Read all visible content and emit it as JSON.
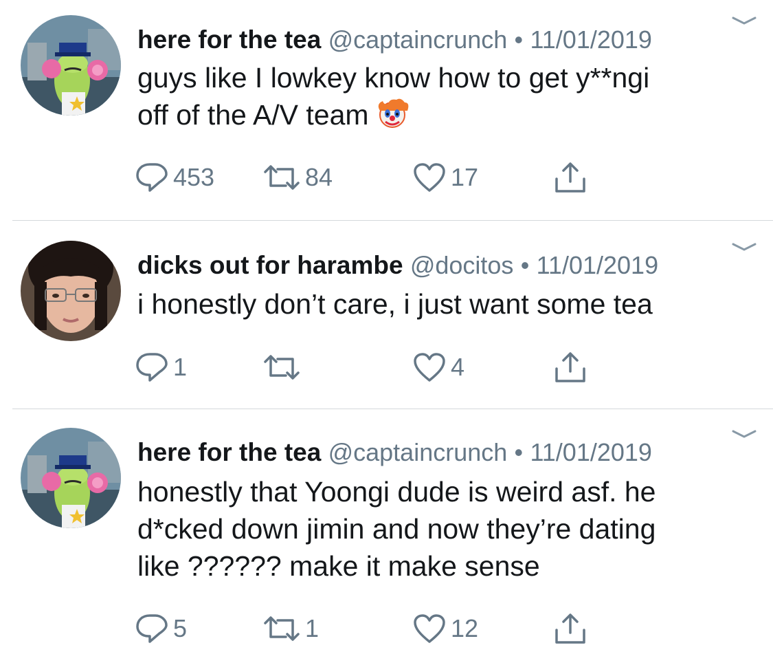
{
  "tweets": [
    {
      "display_name": "here for the tea",
      "handle": "@captaincrunch",
      "separator": "•",
      "date": "11/01/2019",
      "text_lines": [
        "guys like I lowkey know how to get y**ngi",
        "off of the A/V team"
      ],
      "emoji": "clown-face-icon",
      "replies": "453",
      "retweets": "84",
      "likes": "17",
      "avatar": "cartoon-fish-officer"
    },
    {
      "display_name": "dicks out for harambe",
      "handle": "@docitos",
      "separator": "•",
      "date": "11/01/2019",
      "text_lines": [
        "i honestly don’t care, i just want some tea"
      ],
      "replies": "1",
      "retweets": "",
      "likes": "4",
      "avatar": "person-with-glasses"
    },
    {
      "display_name": "here for the tea",
      "handle": "@captaincrunch",
      "separator": "•",
      "date": "11/01/2019",
      "text_lines": [
        "honestly that Yoongi dude is weird asf. he",
        "d*cked down jimin and now they’re dating",
        "like ?????? make it make sense"
      ],
      "replies": "5",
      "retweets": "1",
      "likes": "12",
      "avatar": "cartoon-fish-officer"
    }
  ],
  "colors": {
    "text": "#14171a",
    "secondary": "#657786",
    "divider": "#d4d8db"
  }
}
